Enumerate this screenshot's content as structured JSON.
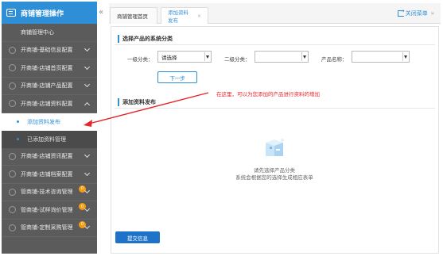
{
  "sidebar": {
    "header": "商铺管理操作",
    "items": [
      {
        "label": "商铺管理中心",
        "type": "plain"
      },
      {
        "label": "开商铺-基础信息配置",
        "type": "group"
      },
      {
        "label": "开商铺-店铺首页配置",
        "type": "group"
      },
      {
        "label": "开商铺-店铺产品配置",
        "type": "group"
      },
      {
        "label": "开商铺-店铺资料配置",
        "type": "group-open"
      },
      {
        "label": "添加资料发布",
        "type": "sub-active"
      },
      {
        "label": "已添加资料管理",
        "type": "sub"
      },
      {
        "label": "开商铺-店铺资讯配置",
        "type": "group"
      },
      {
        "label": "开商铺-店铺档案配置",
        "type": "group"
      },
      {
        "label": "管商铺-技术咨询管理",
        "type": "group",
        "badge": "0"
      },
      {
        "label": "管商铺-试样询价管理",
        "type": "group",
        "badge": "0"
      },
      {
        "label": "管商铺-定制采购管理",
        "type": "group",
        "badge": "0"
      }
    ]
  },
  "topbar": {
    "collapse_glyph": "«",
    "tabs": [
      {
        "label": "商铺管理首页"
      },
      {
        "label": "添加资料发布",
        "close": "×"
      }
    ],
    "close_menu": "关闭菜单",
    "more_glyph": "»"
  },
  "form": {
    "section1_title": "选择产品的系统分类",
    "level1_label": "一级分类：",
    "level1_value": "请选择",
    "level2_label": "二级分类：",
    "level2_value": "",
    "product_label": "产品名称：",
    "product_value": "",
    "next_button": "下一步",
    "section2_title": "添加资料发布",
    "empty_line1": "请先选择产品分类",
    "empty_line2": "系统会根据您的选择生成相应表单",
    "submit_button": "提交信息"
  },
  "annotation": {
    "text": "在这里，可以为您添加的产品进行资料的增加",
    "color": "#e8252b"
  },
  "colors": {
    "accent": "#2f8fd6",
    "sidebar_bg": "#5b5b5b",
    "badge": "#f39c12",
    "submit": "#1e73c8"
  }
}
